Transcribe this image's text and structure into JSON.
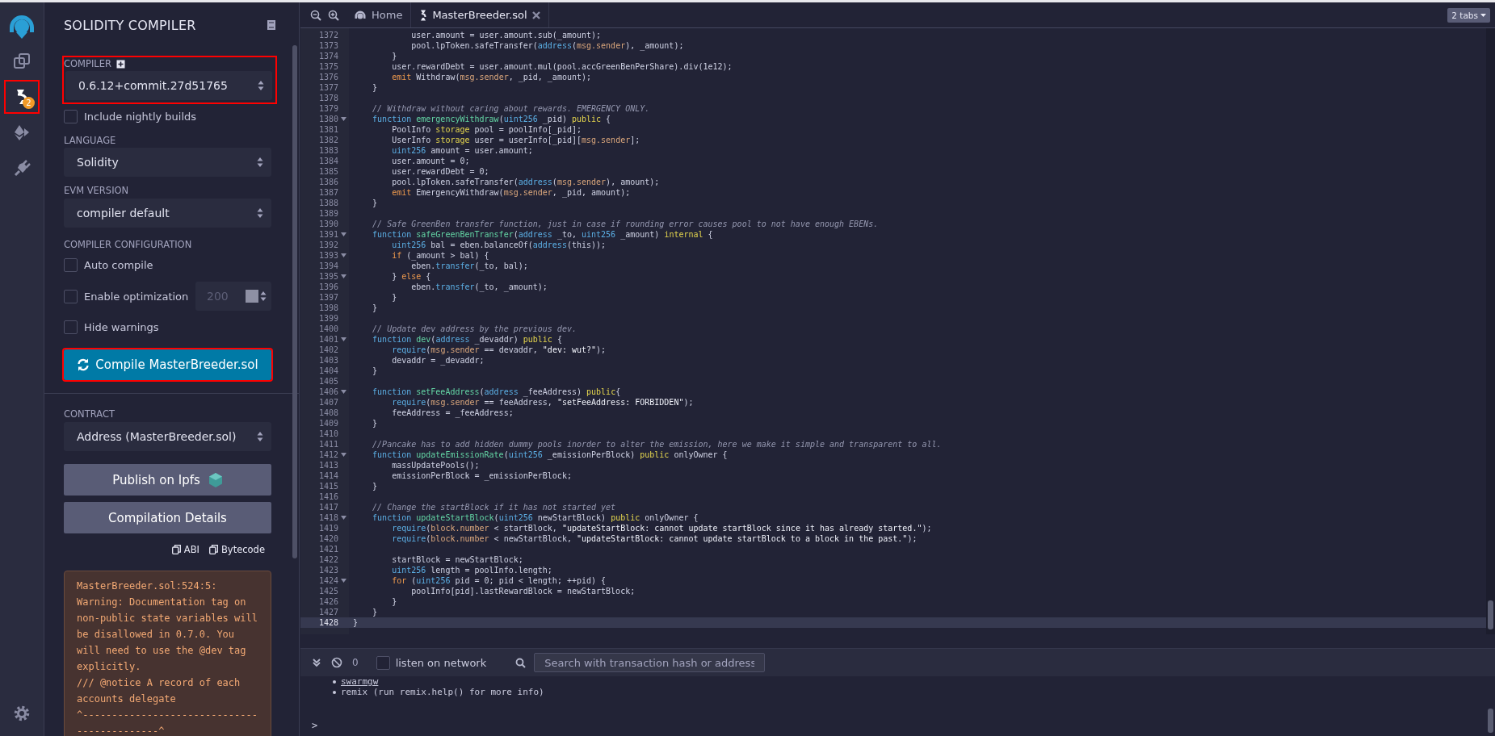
{
  "icon_bar": {
    "items": [
      {
        "kind": "files",
        "selected": false,
        "highlighted": false
      },
      {
        "kind": "compiler",
        "selected": true,
        "highlighted": true,
        "badge": "2"
      },
      {
        "kind": "deploy",
        "selected": false,
        "highlighted": false
      },
      {
        "kind": "plugins",
        "selected": false,
        "highlighted": false
      }
    ]
  },
  "panel": {
    "title": "SOLIDITY COMPILER",
    "compiler": {
      "label": "COMPILER",
      "value": "0.6.12+commit.27d51765",
      "highlighted": true
    },
    "nightly": {
      "label": "Include nightly builds",
      "checked": false
    },
    "language": {
      "label": "LANGUAGE",
      "value": "Solidity"
    },
    "evm": {
      "label": "EVM VERSION",
      "value": "compiler default"
    },
    "config": {
      "label": "COMPILER CONFIGURATION",
      "options": [
        {
          "label": "Auto compile",
          "checked": false
        },
        {
          "label": "Enable optimization",
          "checked": false,
          "runs": {
            "value": "200",
            "disabled": true
          }
        },
        {
          "label": "Hide warnings",
          "checked": false
        }
      ]
    },
    "compile_button": {
      "label": "Compile MasterBreeder.sol",
      "highlighted": true
    },
    "contract": {
      "label": "CONTRACT",
      "value": "Address (MasterBreeder.sol)"
    },
    "buttons": [
      {
        "label": "Publish on Ipfs",
        "kind": "ipfs"
      },
      {
        "label": "Compilation Details",
        "kind": "plain"
      }
    ],
    "copy_links": [
      "ABI",
      "Bytecode"
    ],
    "warning": {
      "lines": [
        "MasterBreeder.sol:524:5:",
        "Warning: Documentation tag on",
        "non-public state variables will",
        "be disallowed in 0.7.0. You",
        "will need to use the @dev tag",
        "explicitly.",
        "/// @notice A record of each",
        "accounts delegate",
        "^------------------------------",
        "--------------^"
      ]
    }
  },
  "editor": {
    "tabs": [
      {
        "label": "Home",
        "kind": "home",
        "selected": false
      },
      {
        "label": "MasterBreeder.sol",
        "kind": "file",
        "selected": true
      }
    ],
    "tabs_menu": "2 tabs",
    "lines": [
      {
        "number": "1372",
        "foldable": false,
        "active": false,
        "tokens": [
          {
            "text": "            user.amount = user.amount.sub(_amount);"
          }
        ]
      },
      {
        "number": "1373",
        "foldable": false,
        "active": false,
        "tokens": [
          {
            "text": "            pool.lpToken.safeTransfer("
          },
          {
            "kind": "keyword",
            "text": "address"
          },
          {
            "text": "("
          },
          {
            "kind": "builtin",
            "text": "msg.sender"
          },
          {
            "text": "), _amount);"
          }
        ]
      },
      {
        "number": "1374",
        "foldable": false,
        "active": false,
        "tokens": [
          {
            "text": "        }"
          }
        ]
      },
      {
        "number": "1375",
        "foldable": false,
        "active": false,
        "tokens": [
          {
            "text": "        user.rewardDebt = user.amount.mul(pool.accGreenBenPerShare).div(1e12);"
          }
        ]
      },
      {
        "number": "1376",
        "foldable": false,
        "active": false,
        "tokens": [
          {
            "kind": "control",
            "text": "        emit"
          },
          {
            "text": " Withdraw("
          },
          {
            "kind": "builtin",
            "text": "msg.sender"
          },
          {
            "text": ", _pid, _amount);"
          }
        ]
      },
      {
        "number": "1377",
        "foldable": false,
        "active": false,
        "tokens": [
          {
            "text": "    }"
          }
        ]
      },
      {
        "number": "1378",
        "foldable": false,
        "active": false
      },
      {
        "number": "1379",
        "foldable": false,
        "active": false,
        "tokens": [
          {
            "kind": "comment",
            "text": "    // Withdraw without caring about rewards. EMERGENCY ONLY."
          }
        ]
      },
      {
        "number": "1380",
        "foldable": true,
        "active": false,
        "tokens": [
          {
            "kind": "keyword",
            "text": "    function"
          },
          {
            "kind": "name",
            "text": " emergencyWithdraw"
          },
          {
            "text": "("
          },
          {
            "kind": "keyword",
            "text": "uint256"
          },
          {
            "text": " _pid) "
          },
          {
            "kind": "modifier",
            "text": "public"
          },
          {
            "text": " {"
          }
        ]
      },
      {
        "number": "1381",
        "foldable": false,
        "active": false,
        "tokens": [
          {
            "text": "        PoolInfo "
          },
          {
            "kind": "modifier",
            "text": "storage"
          },
          {
            "text": " pool = poolInfo[_pid];"
          }
        ]
      },
      {
        "number": "1382",
        "foldable": false,
        "active": false,
        "tokens": [
          {
            "text": "        UserInfo "
          },
          {
            "kind": "modifier",
            "text": "storage"
          },
          {
            "text": " user = userInfo[_pid]["
          },
          {
            "kind": "builtin",
            "text": "msg.sender"
          },
          {
            "text": "];"
          }
        ]
      },
      {
        "number": "1383",
        "foldable": false,
        "active": false,
        "tokens": [
          {
            "kind": "keyword",
            "text": "        uint256"
          },
          {
            "text": " amount = user.amount;"
          }
        ]
      },
      {
        "number": "1384",
        "foldable": false,
        "active": false,
        "tokens": [
          {
            "text": "        user.amount = 0;"
          }
        ]
      },
      {
        "number": "1385",
        "foldable": false,
        "active": false,
        "tokens": [
          {
            "text": "        user.rewardDebt = 0;"
          }
        ]
      },
      {
        "number": "1386",
        "foldable": false,
        "active": false,
        "tokens": [
          {
            "text": "        pool.lpToken.safeTransfer("
          },
          {
            "kind": "keyword",
            "text": "address"
          },
          {
            "text": "("
          },
          {
            "kind": "builtin",
            "text": "msg.sender"
          },
          {
            "text": "), amount);"
          }
        ]
      },
      {
        "number": "1387",
        "foldable": false,
        "active": false,
        "tokens": [
          {
            "kind": "control",
            "text": "        emit"
          },
          {
            "text": " EmergencyWithdraw("
          },
          {
            "kind": "builtin",
            "text": "msg.sender"
          },
          {
            "text": ", _pid, amount);"
          }
        ]
      },
      {
        "number": "1388",
        "foldable": false,
        "active": false,
        "tokens": [
          {
            "text": "    }"
          }
        ]
      },
      {
        "number": "1389",
        "foldable": false,
        "active": false
      },
      {
        "number": "1390",
        "foldable": false,
        "active": false,
        "tokens": [
          {
            "kind": "comment",
            "text": "    // Safe GreenBen transfer function, just in case if rounding error causes pool to not have enough EBENs."
          }
        ]
      },
      {
        "number": "1391",
        "foldable": true,
        "active": false,
        "tokens": [
          {
            "kind": "keyword",
            "text": "    function"
          },
          {
            "kind": "name",
            "text": " safeGreenBenTransfer"
          },
          {
            "text": "("
          },
          {
            "kind": "keyword",
            "text": "address"
          },
          {
            "text": " _to, "
          },
          {
            "kind": "keyword",
            "text": "uint256"
          },
          {
            "text": " _amount) "
          },
          {
            "kind": "modifier",
            "text": "internal"
          },
          {
            "text": " {"
          }
        ]
      },
      {
        "number": "1392",
        "foldable": false,
        "active": false,
        "tokens": [
          {
            "kind": "keyword",
            "text": "        uint256"
          },
          {
            "text": " bal = eben.balanceOf("
          },
          {
            "kind": "keyword",
            "text": "address"
          },
          {
            "text": "(this));"
          }
        ]
      },
      {
        "number": "1393",
        "foldable": true,
        "active": false,
        "tokens": [
          {
            "kind": "control",
            "text": "        if"
          },
          {
            "text": " (_amount > bal) {"
          }
        ]
      },
      {
        "number": "1394",
        "foldable": false,
        "active": false,
        "tokens": [
          {
            "text": "            eben."
          },
          {
            "kind": "keyword",
            "text": "transfer"
          },
          {
            "text": "(_to, bal);"
          }
        ]
      },
      {
        "number": "1395",
        "foldable": true,
        "active": false,
        "tokens": [
          {
            "text": "        } "
          },
          {
            "kind": "control",
            "text": "else"
          },
          {
            "text": " {"
          }
        ]
      },
      {
        "number": "1396",
        "foldable": false,
        "active": false,
        "tokens": [
          {
            "text": "            eben."
          },
          {
            "kind": "keyword",
            "text": "transfer"
          },
          {
            "text": "(_to, _amount);"
          }
        ]
      },
      {
        "number": "1397",
        "foldable": false,
        "active": false,
        "tokens": [
          {
            "text": "        }"
          }
        ]
      },
      {
        "number": "1398",
        "foldable": false,
        "active": false,
        "tokens": [
          {
            "text": "    }"
          }
        ]
      },
      {
        "number": "1399",
        "foldable": false,
        "active": false
      },
      {
        "number": "1400",
        "foldable": false,
        "active": false,
        "tokens": [
          {
            "kind": "comment",
            "text": "    // Update dev address by the previous dev."
          }
        ]
      },
      {
        "number": "1401",
        "foldable": true,
        "active": false,
        "tokens": [
          {
            "kind": "keyword",
            "text": "    function"
          },
          {
            "kind": "name",
            "text": " dev"
          },
          {
            "text": "("
          },
          {
            "kind": "keyword",
            "text": "address"
          },
          {
            "text": " _devaddr) "
          },
          {
            "kind": "modifier",
            "text": "public"
          },
          {
            "text": " {"
          }
        ]
      },
      {
        "number": "1402",
        "foldable": false,
        "active": false,
        "tokens": [
          {
            "kind": "keyword",
            "text": "        require"
          },
          {
            "text": "("
          },
          {
            "kind": "builtin",
            "text": "msg.sender"
          },
          {
            "text": " == devaddr, "
          },
          {
            "kind": "string",
            "text": "\"dev: wut?\""
          },
          {
            "text": ");"
          }
        ]
      },
      {
        "number": "1403",
        "foldable": false,
        "active": false,
        "tokens": [
          {
            "text": "        devaddr = _devaddr;"
          }
        ]
      },
      {
        "number": "1404",
        "foldable": false,
        "active": false,
        "tokens": [
          {
            "text": "    }"
          }
        ]
      },
      {
        "number": "1405",
        "foldable": false,
        "active": false
      },
      {
        "number": "1406",
        "foldable": true,
        "active": false,
        "tokens": [
          {
            "kind": "keyword",
            "text": "    function"
          },
          {
            "kind": "name",
            "text": " setFeeAddress"
          },
          {
            "text": "("
          },
          {
            "kind": "keyword",
            "text": "address"
          },
          {
            "text": " _feeAddress) "
          },
          {
            "kind": "modifier",
            "text": "public"
          },
          {
            "text": "{"
          }
        ]
      },
      {
        "number": "1407",
        "foldable": false,
        "active": false,
        "tokens": [
          {
            "kind": "keyword",
            "text": "        require"
          },
          {
            "text": "("
          },
          {
            "kind": "builtin",
            "text": "msg.sender"
          },
          {
            "text": " == feeAddress, "
          },
          {
            "kind": "string",
            "text": "\"setFeeAddress: FORBIDDEN\""
          },
          {
            "text": ");"
          }
        ]
      },
      {
        "number": "1408",
        "foldable": false,
        "active": false,
        "tokens": [
          {
            "text": "        feeAddress = _feeAddress;"
          }
        ]
      },
      {
        "number": "1409",
        "foldable": false,
        "active": false,
        "tokens": [
          {
            "text": "    }"
          }
        ]
      },
      {
        "number": "1410",
        "foldable": false,
        "active": false
      },
      {
        "number": "1411",
        "foldable": false,
        "active": false,
        "tokens": [
          {
            "kind": "comment",
            "text": "    //Pancake has to add hidden dummy pools inorder to alter the emission, here we make it simple and transparent to all."
          }
        ]
      },
      {
        "number": "1412",
        "foldable": true,
        "active": false,
        "tokens": [
          {
            "kind": "keyword",
            "text": "    function"
          },
          {
            "kind": "name",
            "text": " updateEmissionRate"
          },
          {
            "text": "("
          },
          {
            "kind": "keyword",
            "text": "uint256"
          },
          {
            "text": " _emissionPerBlock) "
          },
          {
            "kind": "modifier",
            "text": "public"
          },
          {
            "text": " onlyOwner {"
          }
        ]
      },
      {
        "number": "1413",
        "foldable": false,
        "active": false,
        "tokens": [
          {
            "text": "        massUpdatePools();"
          }
        ]
      },
      {
        "number": "1414",
        "foldable": false,
        "active": false,
        "tokens": [
          {
            "text": "        emissionPerBlock = _emissionPerBlock;"
          }
        ]
      },
      {
        "number": "1415",
        "foldable": false,
        "active": false,
        "tokens": [
          {
            "text": "    }"
          }
        ]
      },
      {
        "number": "1416",
        "foldable": false,
        "active": false
      },
      {
        "number": "1417",
        "foldable": false,
        "active": false,
        "tokens": [
          {
            "kind": "comment",
            "text": "    // Change the startBlock if it has not started yet"
          }
        ]
      },
      {
        "number": "1418",
        "foldable": true,
        "active": false,
        "tokens": [
          {
            "kind": "keyword",
            "text": "    function"
          },
          {
            "kind": "name",
            "text": " updateStartBlock"
          },
          {
            "text": "("
          },
          {
            "kind": "keyword",
            "text": "uint256"
          },
          {
            "text": " newStartBlock) "
          },
          {
            "kind": "modifier",
            "text": "public"
          },
          {
            "text": " onlyOwner {"
          }
        ]
      },
      {
        "number": "1419",
        "foldable": false,
        "active": false,
        "tokens": [
          {
            "kind": "keyword",
            "text": "        require"
          },
          {
            "text": "("
          },
          {
            "kind": "builtin",
            "text": "block.number"
          },
          {
            "text": " < startBlock, "
          },
          {
            "kind": "string",
            "text": "\"updateStartBlock: cannot update startBlock since it has already started.\""
          },
          {
            "text": ");"
          }
        ]
      },
      {
        "number": "1420",
        "foldable": false,
        "active": false,
        "tokens": [
          {
            "kind": "keyword",
            "text": "        require"
          },
          {
            "text": "("
          },
          {
            "kind": "builtin",
            "text": "block.number"
          },
          {
            "text": " < newStartBlock, "
          },
          {
            "kind": "string",
            "text": "\"updateStartBlock: cannot update startBlock to a block in the past.\""
          },
          {
            "text": ");"
          }
        ]
      },
      {
        "number": "1421",
        "foldable": false,
        "active": false
      },
      {
        "number": "1422",
        "foldable": false,
        "active": false,
        "tokens": [
          {
            "text": "        startBlock = newStartBlock;"
          }
        ]
      },
      {
        "number": "1423",
        "foldable": false,
        "active": false,
        "tokens": [
          {
            "kind": "keyword",
            "text": "        uint256"
          },
          {
            "text": " length = poolInfo.length;"
          }
        ]
      },
      {
        "number": "1424",
        "foldable": true,
        "active": false,
        "tokens": [
          {
            "kind": "control",
            "text": "        for"
          },
          {
            "text": " ("
          },
          {
            "kind": "keyword",
            "text": "uint256"
          },
          {
            "text": " pid = 0; pid < length; ++pid) {"
          }
        ]
      },
      {
        "number": "1425",
        "foldable": false,
        "active": false,
        "tokens": [
          {
            "text": "            poolInfo[pid].lastRewardBlock = newStartBlock;"
          }
        ]
      },
      {
        "number": "1426",
        "foldable": false,
        "active": false,
        "tokens": [
          {
            "text": "        }"
          }
        ]
      },
      {
        "number": "1427",
        "foldable": false,
        "active": false,
        "tokens": [
          {
            "text": "    }"
          }
        ]
      },
      {
        "number": "1428",
        "foldable": false,
        "active": true,
        "tokens": [
          {
            "text": "}"
          }
        ]
      }
    ]
  },
  "terminal": {
    "count": "0",
    "listen": {
      "label": "listen on network",
      "checked": false
    },
    "search": {
      "placeholder": "Search with transaction hash or address"
    },
    "output": [
      {
        "kind": "link",
        "text": "swarmgw"
      },
      {
        "kind": "plain",
        "text": "remix (run remix.help() for more info)"
      }
    ],
    "prompt": ">"
  }
}
